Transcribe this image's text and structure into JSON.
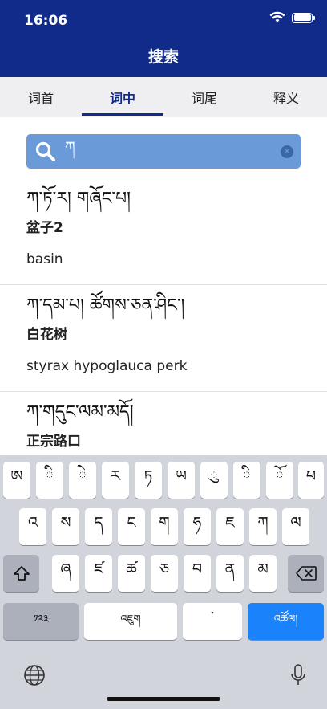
{
  "status": {
    "time": "16:06"
  },
  "header": {
    "title": "搜索"
  },
  "tabs": [
    {
      "label": "词首"
    },
    {
      "label": "词中"
    },
    {
      "label": "词尾"
    },
    {
      "label": "释义"
    }
  ],
  "search": {
    "value": "ཀ"
  },
  "results": [
    {
      "tibetan": "ཀ་ཏོ་ར། གཞོང་པ།",
      "chinese": "盆子2",
      "english": "basin"
    },
    {
      "tibetan": "ཀ་དམ་པ། ཚོགས་ཅན་ཤིང་།",
      "chinese": "白花树",
      "english": "styrax hypoglauca perk"
    },
    {
      "tibetan": "ཀ་གདུང་ལམ་མདོ།",
      "chinese": "正宗路口",
      "english": ""
    }
  ],
  "keyboard": {
    "row1": [
      "ཨ",
      "ི",
      "ེ",
      "ར",
      "ཏ",
      "ཡ",
      "ུ",
      "ི",
      "ོ",
      "པ"
    ],
    "row2": [
      " འ",
      "ས",
      "ད",
      "ང",
      "ག",
      "ཧ",
      "ཇ",
      "ཀ",
      "ལ"
    ],
    "row3": [
      "ཞ",
      "ཛ",
      "ཚ",
      "ཅ",
      "བ",
      "ན",
      "མ"
    ],
    "numbers_label": "༡༢༣",
    "space_label": "འཇུག",
    "tsheg_label": "་",
    "return_label": "འཚོལ།"
  }
}
